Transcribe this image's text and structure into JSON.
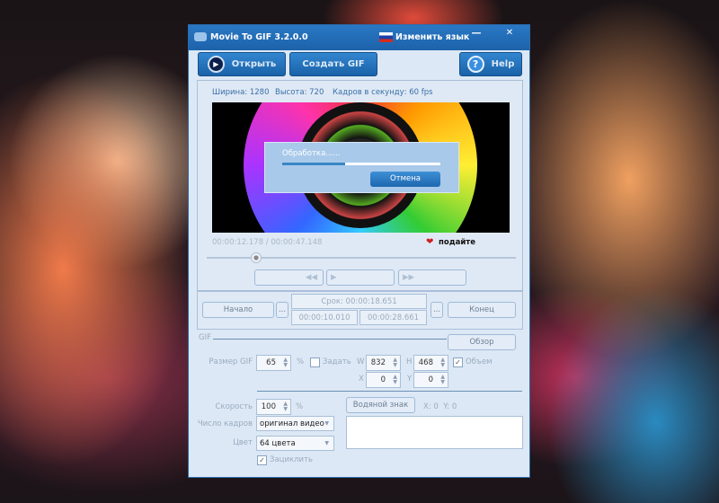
{
  "window": {
    "title": "Movie To GIF 3.2.0.0",
    "language_label": "Изменить язык",
    "minimize": "—",
    "close": "✕"
  },
  "toolbar": {
    "open": "Открыть",
    "create_gif": "Создать GIF",
    "help": "Help"
  },
  "info": {
    "width": "Ширина: 1280",
    "height": "Высота: 720",
    "fps": "Кадров в секунду: 60 fps"
  },
  "dialog": {
    "text": "Обработка......",
    "progress": 0.4,
    "cancel": "Отмена"
  },
  "player": {
    "time": "00:00:12.178 / 00:00:47.148",
    "donate": "подайте",
    "position": 0.16,
    "rewind": "◀◀",
    "play": "▶",
    "forward": "▶▶"
  },
  "range": {
    "start_btn": "Начало",
    "dots": "...",
    "duration": "Срок: 00:00:18.651",
    "start_time": "00:00:10.010",
    "end_time": "00:00:28.661",
    "end_btn": "Конец"
  },
  "gif": {
    "section": "GIF",
    "browse": "Обзор",
    "size_label": "Размер GIF",
    "size_value": "65",
    "percent": "%",
    "set_label": "Задать",
    "set_checked": false,
    "w_label": "W",
    "w_value": "832",
    "h_label": "H",
    "h_value": "468",
    "volume_label": "Объем",
    "volume_checked": true,
    "x_label": "X",
    "x_value": "0",
    "y_label": "Y",
    "y_value": "0",
    "speed_label": "Скорость",
    "speed_value": "100",
    "watermark_btn": "Водяной знак",
    "watermark_pos": "X: 0  Y: 0",
    "frames_label": "Число кадров",
    "frames_value": "оригинал видео",
    "color_label": "Цвет",
    "color_value": "64 цвета",
    "loop_label": "Зациклить",
    "loop_checked": true
  }
}
